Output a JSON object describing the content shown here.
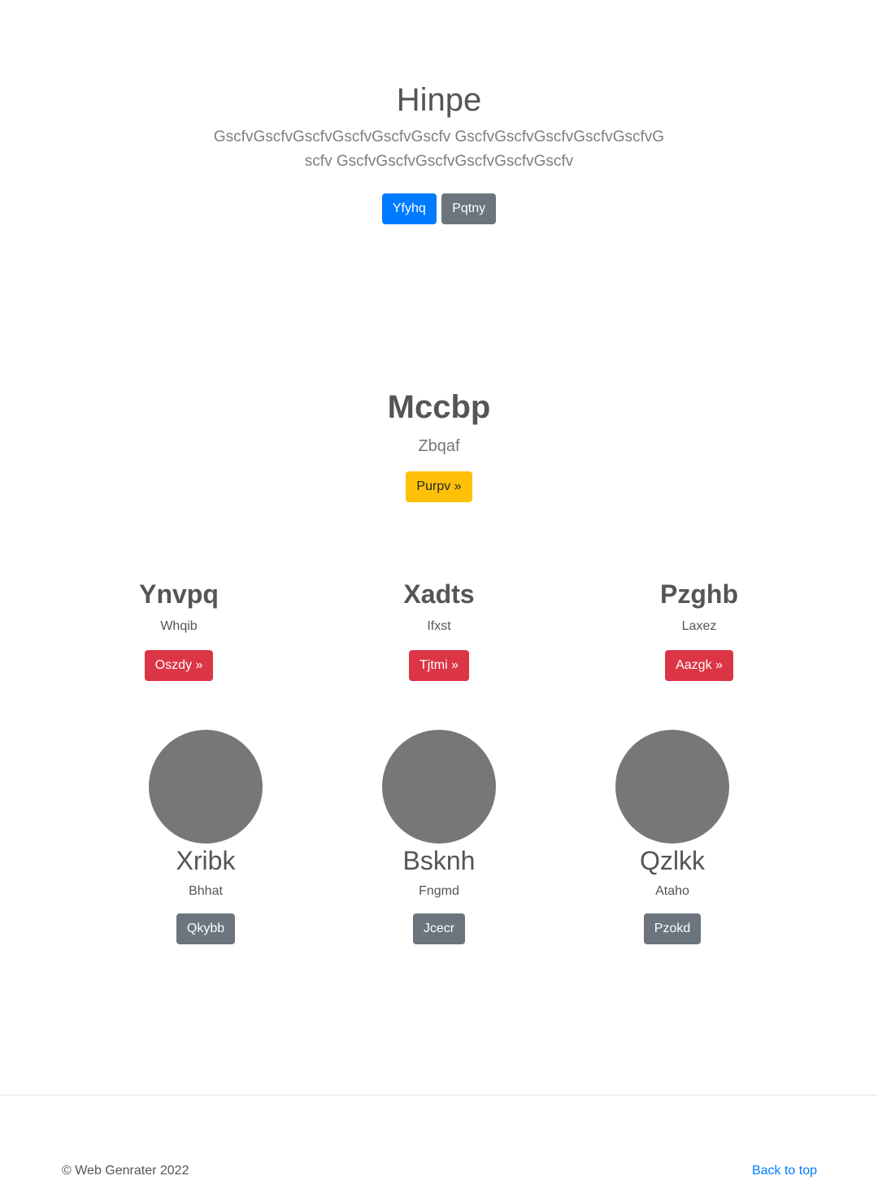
{
  "hero": {
    "title": "Hinpe",
    "lead": "GscfvGscfvGscfvGscfvGscfvGscfv GscfvGscfvGscfvGscfvGscfvGscfv GscfvGscfvGscfvGscfvGscfvGscfv",
    "primary_button": "Yfyhq",
    "secondary_button": "Pqtny"
  },
  "feature": {
    "title": "Mccbp",
    "subtitle": "Zbqaf",
    "button": "Purpv »"
  },
  "columns": [
    {
      "title": "Ynvpq",
      "text": "Whqib",
      "button": "Oszdy »"
    },
    {
      "title": "Xadts",
      "text": "Ifxst",
      "button": "Tjtmi »"
    },
    {
      "title": "Pzghb",
      "text": "Laxez",
      "button": "Aazgk »"
    }
  ],
  "cards": [
    {
      "title": "Xribk",
      "text": "Bhhat",
      "button": "Qkybb"
    },
    {
      "title": "Bsknh",
      "text": "Fngmd",
      "button": "Jcecr"
    },
    {
      "title": "Qzlkk",
      "text": "Ataho",
      "button": "Pzokd"
    }
  ],
  "footer": {
    "copyright": "© Web Genrater 2022",
    "back_to_top": "Back to top"
  },
  "colors": {
    "primary": "#007bff",
    "secondary": "#6c757d",
    "warning": "#ffc107",
    "danger": "#dc3545",
    "placeholder_circle": "#777777"
  }
}
